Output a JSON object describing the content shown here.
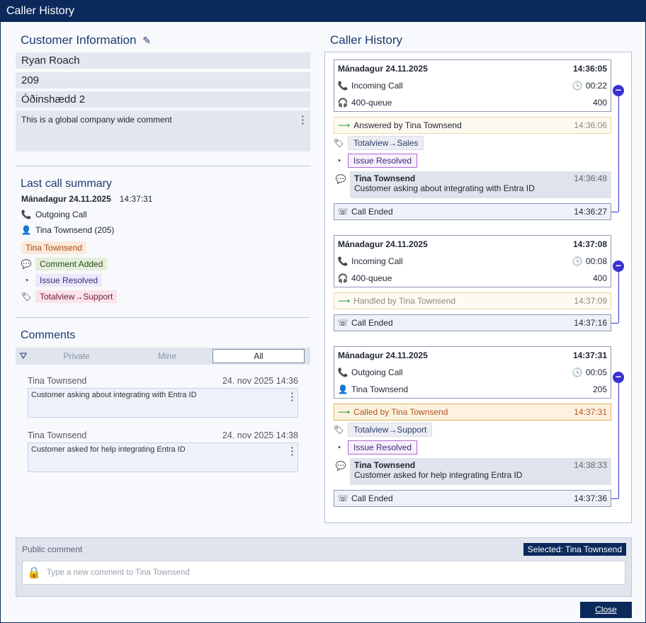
{
  "window": {
    "title": "Caller History"
  },
  "customer": {
    "heading": "Customer Information",
    "name": "Ryan Roach",
    "number": "209",
    "address": "Óðinshædd 2",
    "global_comment": "This is a global company wide comment"
  },
  "last_call": {
    "heading": "Last call summary",
    "date": "Mánadagur 24.11.2025",
    "time": "14:37:31",
    "direction": "Outgoing Call",
    "agent": "Tina Townsend (205)",
    "agent_chip": "Tina Townsend",
    "comment_chip": "Comment Added",
    "status_chip": "Issue Resolved",
    "transfer_chip": "Totalview→Support",
    "colors": {
      "agent_chip_bg": "#fde9d9",
      "comment_chip_bg": "#e3eedb",
      "status_chip_bg": "#ece8fb",
      "transfer_chip_bg": "#fbe3ea"
    }
  },
  "comments": {
    "heading": "Comments",
    "tabs": [
      "Private",
      "Mine",
      "All"
    ],
    "active_tab": "All",
    "items": [
      {
        "author": "Tina Townsend",
        "date": "24. nov 2025 14:36",
        "text": "Customer asking about integrating with Entra ID"
      },
      {
        "author": "Tina Townsend",
        "date": "24. nov 2025 14:38",
        "text": "Customer asked for help integrating Entra ID"
      }
    ]
  },
  "history": {
    "heading": "Caller History",
    "calls": [
      {
        "date": "Mánadagur 24.11.2025",
        "time": "14:36:05",
        "direction": "Incoming Call",
        "duration": "00:22",
        "queue": "400-queue",
        "queue_num": "400",
        "event": "Answered by Tina Townsend",
        "event_time": "14:36:06",
        "transfer": "Totalview→Sales",
        "status": "Issue Resolved",
        "comment_author": "Tina Townsend",
        "comment_time": "14:36:48",
        "comment_text": "Customer asking about integrating with Entra ID",
        "end_label": "Call Ended",
        "end_time": "14:36:27"
      },
      {
        "date": "Mánadagur 24.11.2025",
        "time": "14:37:08",
        "direction": "Incoming Call",
        "duration": "00:08",
        "queue": "400-queue",
        "queue_num": "400",
        "event": "Handled by Tina Townsend",
        "event_time": "14:37:09",
        "end_label": "Call Ended",
        "end_time": "14:37:16"
      },
      {
        "date": "Mánadagur 24.11.2025",
        "time": "14:37:31",
        "direction": "Outgoing Call",
        "duration": "00:05",
        "agent": "Tina Townsend",
        "agent_num": "205",
        "event": "Called by Tina Townsend",
        "event_time": "14:37:31",
        "transfer": "Totalview→Support",
        "status": "Issue Resolved",
        "comment_author": "Tina Townsend",
        "comment_time": "14:38:33",
        "comment_text": "Customer asked for help integrating Entra ID",
        "end_label": "Call Ended",
        "end_time": "14:37:36"
      }
    ]
  },
  "public_comment": {
    "label": "Public comment",
    "selected": "Selected: Tina Townsend",
    "placeholder": "Type a new comment to Tina Townsend"
  },
  "footer": {
    "close_label": "Close"
  },
  "colors": {
    "primary": "#0b2a5b",
    "timeline": "#3a2fd0",
    "heading": "#1d3a6e"
  }
}
